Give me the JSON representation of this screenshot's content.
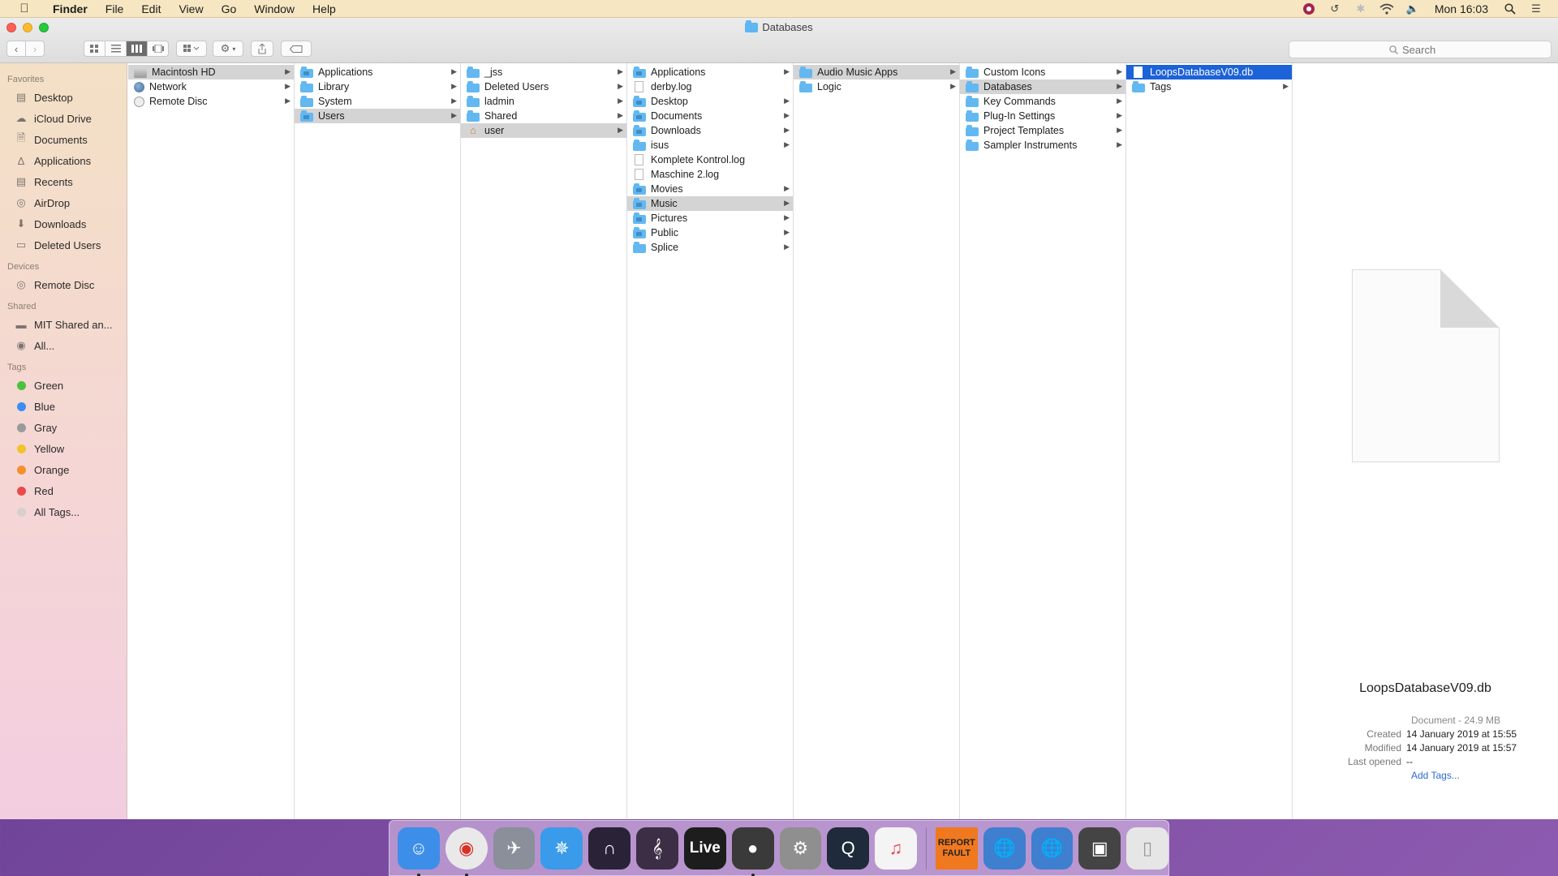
{
  "menubar": {
    "app": "Finder",
    "items": [
      "File",
      "Edit",
      "View",
      "Go",
      "Window",
      "Help"
    ],
    "clock": "Mon 16:03"
  },
  "window": {
    "title": "Databases",
    "search_placeholder": "Search"
  },
  "sidebar": {
    "favorites_header": "Favorites",
    "favorites": [
      {
        "label": "Desktop",
        "icon": "desktop-icon"
      },
      {
        "label": "iCloud Drive",
        "icon": "cloud-icon"
      },
      {
        "label": "Documents",
        "icon": "documents-icon"
      },
      {
        "label": "Applications",
        "icon": "applications-icon"
      },
      {
        "label": "Recents",
        "icon": "recents-icon"
      },
      {
        "label": "AirDrop",
        "icon": "airdrop-icon"
      },
      {
        "label": "Downloads",
        "icon": "downloads-icon"
      },
      {
        "label": "Deleted Users",
        "icon": "folder-icon"
      }
    ],
    "devices_header": "Devices",
    "devices": [
      {
        "label": "Remote Disc",
        "icon": "disc-icon"
      }
    ],
    "shared_header": "Shared",
    "shared": [
      {
        "label": "MIT Shared an...",
        "icon": "server-icon"
      },
      {
        "label": "All...",
        "icon": "network-icon"
      }
    ],
    "tags_header": "Tags",
    "tags": [
      {
        "label": "Green",
        "color": "#4cc13f"
      },
      {
        "label": "Blue",
        "color": "#3a8ef3"
      },
      {
        "label": "Gray",
        "color": "#9a9a9a"
      },
      {
        "label": "Yellow",
        "color": "#f3c22c"
      },
      {
        "label": "Orange",
        "color": "#f5902c"
      },
      {
        "label": "Red",
        "color": "#ec4a4a"
      },
      {
        "label": "All Tags...",
        "color": "#d8d0cc"
      }
    ]
  },
  "columns": [
    [
      {
        "label": "Macintosh HD",
        "icon": "disk",
        "arrow": true,
        "state": "sel"
      },
      {
        "label": "Network",
        "icon": "globe",
        "arrow": true
      },
      {
        "label": "Remote Disc",
        "icon": "disc",
        "arrow": true
      }
    ],
    [
      {
        "label": "Applications",
        "icon": "folder special",
        "arrow": true
      },
      {
        "label": "Library",
        "icon": "folder",
        "arrow": true
      },
      {
        "label": "System",
        "icon": "folder",
        "arrow": true
      },
      {
        "label": "Users",
        "icon": "folder special",
        "arrow": true,
        "state": "sel"
      }
    ],
    [
      {
        "label": "_jss",
        "icon": "folder",
        "arrow": true
      },
      {
        "label": "Deleted Users",
        "icon": "folder",
        "arrow": true
      },
      {
        "label": "ladmin",
        "icon": "folder",
        "arrow": true
      },
      {
        "label": "Shared",
        "icon": "folder",
        "arrow": true
      },
      {
        "label": "user",
        "icon": "home",
        "arrow": true,
        "state": "sel"
      }
    ],
    [
      {
        "label": "Applications",
        "icon": "folder special",
        "arrow": true
      },
      {
        "label": "derby.log",
        "icon": "doc",
        "arrow": false
      },
      {
        "label": "Desktop",
        "icon": "folder special",
        "arrow": true
      },
      {
        "label": "Documents",
        "icon": "folder special",
        "arrow": true
      },
      {
        "label": "Downloads",
        "icon": "folder special",
        "arrow": true
      },
      {
        "label": "isus",
        "icon": "folder",
        "arrow": true
      },
      {
        "label": "Komplete Kontrol.log",
        "icon": "doc",
        "arrow": false
      },
      {
        "label": "Maschine 2.log",
        "icon": "doc",
        "arrow": false
      },
      {
        "label": "Movies",
        "icon": "folder special",
        "arrow": true
      },
      {
        "label": "Music",
        "icon": "folder special",
        "arrow": true,
        "state": "sel"
      },
      {
        "label": "Pictures",
        "icon": "folder special",
        "arrow": true
      },
      {
        "label": "Public",
        "icon": "folder special",
        "arrow": true
      },
      {
        "label": "Splice",
        "icon": "folder",
        "arrow": true
      }
    ],
    [
      {
        "label": "Audio Music Apps",
        "icon": "folder",
        "arrow": true,
        "state": "sel"
      },
      {
        "label": "Logic",
        "icon": "folder",
        "arrow": true
      }
    ],
    [
      {
        "label": "Custom Icons",
        "icon": "folder",
        "arrow": true
      },
      {
        "label": "Databases",
        "icon": "folder",
        "arrow": true,
        "state": "sel"
      },
      {
        "label": "Key Commands",
        "icon": "folder",
        "arrow": true
      },
      {
        "label": "Plug-In Settings",
        "icon": "folder",
        "arrow": true
      },
      {
        "label": "Project Templates",
        "icon": "folder",
        "arrow": true
      },
      {
        "label": "Sampler Instruments",
        "icon": "folder",
        "arrow": true
      }
    ],
    [
      {
        "label": "LoopsDatabaseV09.db",
        "icon": "doc blue",
        "arrow": false,
        "state": "sel-active"
      },
      {
        "label": "Tags",
        "icon": "folder",
        "arrow": true
      }
    ]
  ],
  "preview": {
    "name": "LoopsDatabaseV09.db",
    "kind": "Document - 24.9 MB",
    "created_label": "Created",
    "created": "14 January 2019 at 15:55",
    "modified_label": "Modified",
    "modified": "14 January 2019 at 15:57",
    "opened_label": "Last opened",
    "opened": "--",
    "add_tags": "Add Tags..."
  },
  "dock": {
    "report_fault": "REPORT FAULT",
    "live_label": "Live",
    "apps": [
      {
        "name": "finder-icon",
        "bg": "#3d8ee8",
        "running": true
      },
      {
        "name": "chrome-icon",
        "bg": "#e9e9e9",
        "running": true
      },
      {
        "name": "launchpad-icon",
        "bg": "#8a8f99",
        "running": false
      },
      {
        "name": "safari-icon",
        "bg": "#3a9bea",
        "running": false
      },
      {
        "name": "pro-tools-icon",
        "bg": "#2a2337",
        "running": false
      },
      {
        "name": "sibelius-icon",
        "bg": "#3c2e45",
        "running": false
      },
      {
        "name": "ableton-live-icon",
        "bg": "#1d1d1d",
        "running": false
      },
      {
        "name": "logic-icon",
        "bg": "#3a3a3a",
        "running": true
      },
      {
        "name": "system-preferences-icon",
        "bg": "#8f8f8f",
        "running": false
      },
      {
        "name": "quicktime-icon",
        "bg": "#1f2a3a",
        "running": false
      },
      {
        "name": "itunes-icon",
        "bg": "#f4f4f4",
        "running": false
      }
    ],
    "extras": [
      {
        "name": "report-fault-icon",
        "bg": "#f0781f"
      },
      {
        "name": "network-globe-icon",
        "bg": "#3f7fcf"
      },
      {
        "name": "network-globe-2-icon",
        "bg": "#3f7fcf"
      },
      {
        "name": "camera-icon",
        "bg": "#444444"
      },
      {
        "name": "trash-icon",
        "bg": "#e6e6e6"
      }
    ]
  }
}
